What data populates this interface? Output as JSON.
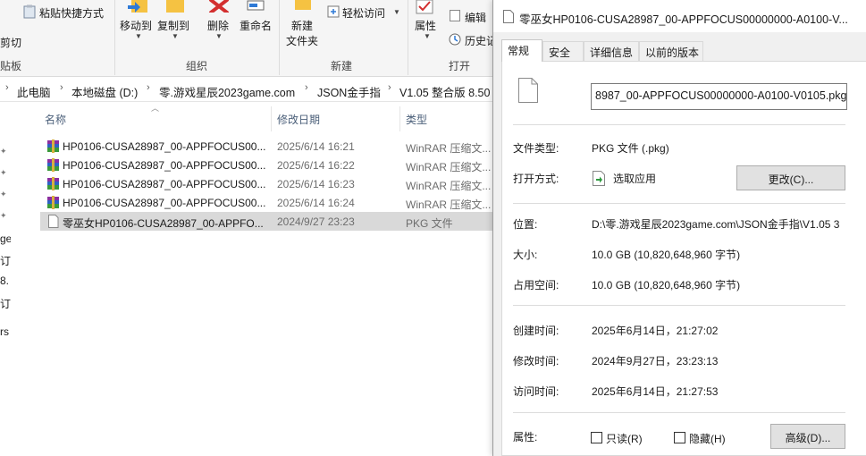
{
  "ribbon": {
    "clipboard_partial_label": "剪切",
    "paste_shortcut": "粘贴快捷方式",
    "move_to": "移动到",
    "copy_to": "复制到",
    "delete": "删除",
    "rename": "重命名",
    "new_folder_line1": "新建",
    "new_folder_line2": "文件夹",
    "easy_access": "轻松访问",
    "properties": "属性",
    "edit": "编辑",
    "history": "历史记",
    "groups": {
      "clipboard_partial": "贴板",
      "organize": "组织",
      "new": "新建",
      "open": "打开"
    }
  },
  "address": {
    "crumbs": [
      "此电脑",
      "本地磁盘 (D:)",
      "零.游戏星辰2023game.com",
      "JSON金手指",
      "V1.05 整合版 8.50"
    ]
  },
  "nav_partial": [
    "ge",
    "订",
    "8.",
    "订",
    "rs"
  ],
  "filelist": {
    "columns": {
      "name": "名称",
      "date": "修改日期",
      "type": "类型"
    },
    "rows": [
      {
        "name": "HP0106-CUSA28987_00-APPFOCUS00...",
        "date": "2025/6/14 16:21",
        "type": "WinRAR 压缩文...",
        "icon": "winrar-archive-icon",
        "selected": false
      },
      {
        "name": "HP0106-CUSA28987_00-APPFOCUS00...",
        "date": "2025/6/14 16:22",
        "type": "WinRAR 压缩文...",
        "icon": "winrar-archive-icon",
        "selected": false
      },
      {
        "name": "HP0106-CUSA28987_00-APPFOCUS00...",
        "date": "2025/6/14 16:23",
        "type": "WinRAR 压缩文...",
        "icon": "winrar-archive-icon",
        "selected": false
      },
      {
        "name": "HP0106-CUSA28987_00-APPFOCUS00...",
        "date": "2025/6/14 16:24",
        "type": "WinRAR 压缩文...",
        "icon": "winrar-archive-icon",
        "selected": false
      },
      {
        "name": "零巫女HP0106-CUSA28987_00-APPFO...",
        "date": "2024/9/27 23:23",
        "type": "PKG 文件",
        "icon": "blank-file-icon",
        "selected": true
      }
    ]
  },
  "dialog": {
    "title": "零巫女HP0106-CUSA28987_00-APPFOCUS00000000-A0100-V...",
    "tabs": [
      "常规",
      "安全",
      "详细信息",
      "以前的版本"
    ],
    "active_tab": "常规",
    "filename": "8987_00-APPFOCUS00000000-A0100-V0105.pkg",
    "file_type_label": "文件类型:",
    "file_type_value": "PKG 文件 (.pkg)",
    "opens_with_label": "打开方式:",
    "opens_with_value": "选取应用",
    "change_button": "更改(C)...",
    "location_label": "位置:",
    "location_value": "D:\\零.游戏星辰2023game.com\\JSON金手指\\V1.05 3",
    "size_label": "大小:",
    "size_value": "10.0 GB (10,820,648,960 字节)",
    "size_on_disk_label": "占用空间:",
    "size_on_disk_value": "10.0 GB (10,820,648,960 字节)",
    "created_label": "创建时间:",
    "created_value": "2025年6月14日，21:27:02",
    "modified_label": "修改时间:",
    "modified_value": "2024年9月27日，23:23:13",
    "accessed_label": "访问时间:",
    "accessed_value": "2025年6月14日，21:27:53",
    "attributes_label": "属性:",
    "readonly_label": "只读(R)",
    "hidden_label": "隐藏(H)",
    "advanced_button": "高级(D)..."
  },
  "colors": {
    "selected_row": "#d9d9d9",
    "column_header": "#4c607a",
    "delete_red": "#d32f2f",
    "folder_yellow": "#f5c242"
  }
}
